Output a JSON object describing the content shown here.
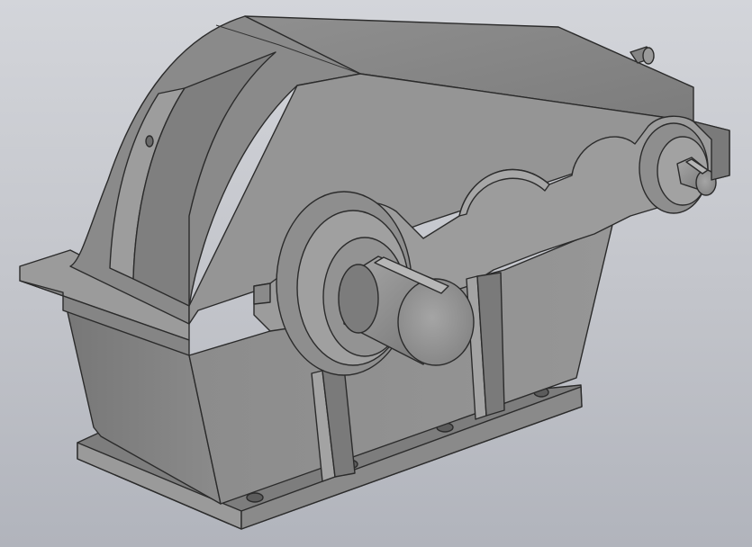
{
  "scene": {
    "model": "gearbox-housing-3d",
    "background_top": "#d3d5da",
    "background_bottom": "#b1b4bc",
    "part_face_light": "#9a9a9a",
    "part_face_mid": "#8a8a8a",
    "part_face_dark": "#6e6e6e",
    "edge_color": "#2b2b2b"
  }
}
